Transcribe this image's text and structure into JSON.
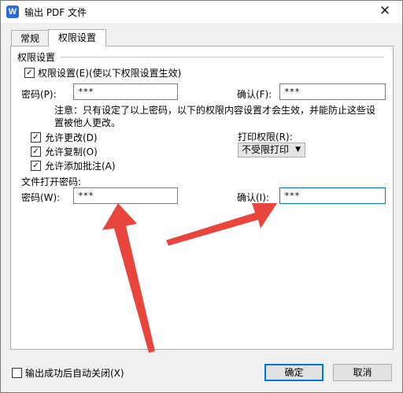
{
  "window": {
    "title": "输出 PDF 文件",
    "icon": "wps-writer-icon",
    "close_glyph": "✕"
  },
  "tabs": [
    {
      "label": "常规",
      "active": false
    },
    {
      "label": "权限设置",
      "active": true
    }
  ],
  "permissions": {
    "group_title": "权限设置",
    "enable_checkbox": {
      "label": "权限设置(E)(使以下权限设置生效)",
      "checked": true
    },
    "password_label": "密码(P):",
    "password_value": "***",
    "confirm_label": "确认(F):",
    "confirm_value": "***",
    "note_line1": "注意：只有设定了以上密码，以下的权限内容设置才会生效，并能防止这些设",
    "note_line2": "置被他人更改。",
    "options": [
      {
        "label": "允许更改(D)",
        "checked": true
      },
      {
        "label": "允许复制(O)",
        "checked": true
      },
      {
        "label": "允许添加批注(A)",
        "checked": true
      }
    ],
    "print_label": "打印权限(R):",
    "print_value": "不受限打印"
  },
  "open_password": {
    "title": "文件打开密码:",
    "password_label": "密码(W):",
    "password_value": "***",
    "confirm_label": "确认(I):",
    "confirm_value": "***"
  },
  "footer": {
    "auto_close_label": "输出成功后自动关闭(X)",
    "auto_close_checked": false,
    "ok_label": "确定",
    "cancel_label": "取消"
  },
  "annotation": {
    "arrow_color": "#e8453c"
  }
}
